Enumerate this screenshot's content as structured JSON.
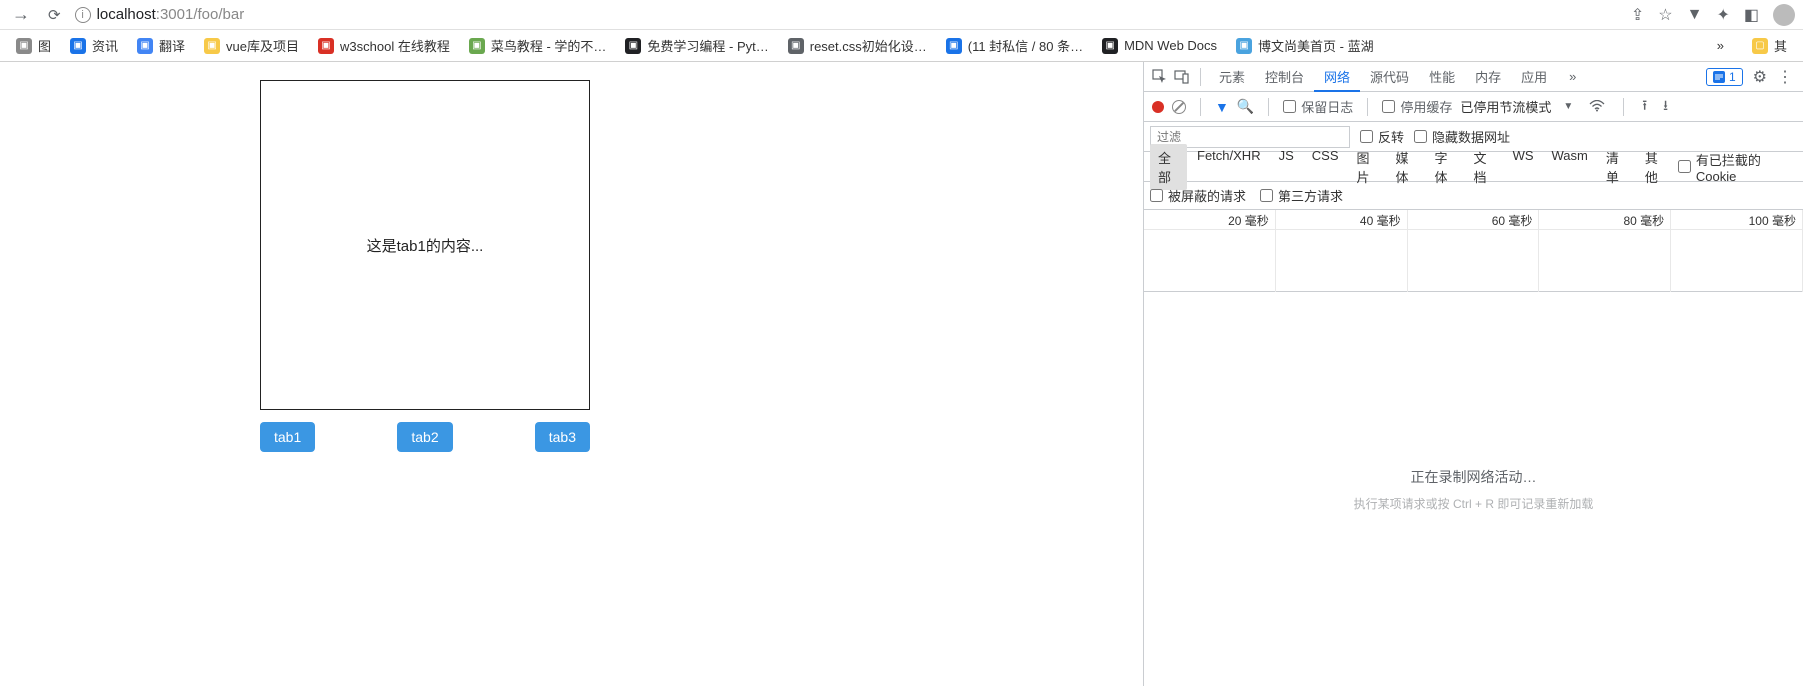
{
  "browser": {
    "url_display": "localhost:3001/foo/bar",
    "host": "localhost",
    "path": ":3001/foo/bar"
  },
  "bookmarks": [
    {
      "label": "图",
      "color": "#8a8a8a"
    },
    {
      "label": "资讯",
      "color": "#1a73e8"
    },
    {
      "label": "翻译",
      "color": "#4285f4"
    },
    {
      "label": "vue库及项目",
      "color": "#f7c948"
    },
    {
      "label": "w3school 在线教程",
      "color": "#d93025"
    },
    {
      "label": "菜鸟教程 - 学的不…",
      "color": "#6aa84f"
    },
    {
      "label": "免费学习编程 - Pyt…",
      "color": "#202124"
    },
    {
      "label": "reset.css初始化设…",
      "color": "#5f6368"
    },
    {
      "label": "(11 封私信 / 80 条…",
      "color": "#1a73e8"
    },
    {
      "label": "MDN Web Docs",
      "color": "#202124"
    },
    {
      "label": "博文尚美首页 - 蓝湖",
      "color": "#4aa3df"
    }
  ],
  "bookmarks_more": "»",
  "bookmarks_folder": "其",
  "page": {
    "content": "这是tab1的内容...",
    "tabs": [
      "tab1",
      "tab2",
      "tab3"
    ]
  },
  "devtools": {
    "tabs": [
      "元素",
      "控制台",
      "网络",
      "源代码",
      "性能",
      "内存",
      "应用"
    ],
    "active_tab": "网络",
    "more_tabs": "»",
    "issue_count": "1",
    "row2": {
      "preserve_log": "保留日志",
      "disable_cache": "停用缓存",
      "throttling": "已停用节流模式"
    },
    "row3": {
      "filter_placeholder": "过滤",
      "invert": "反转",
      "hide_data_urls": "隐藏数据网址"
    },
    "filters": [
      "全部",
      "Fetch/XHR",
      "JS",
      "CSS",
      "图片",
      "媒体",
      "字体",
      "文档",
      "WS",
      "Wasm",
      "清单",
      "其他"
    ],
    "active_filter": "全部",
    "blocked_cookies": "有已拦截的 Cookie",
    "row5": {
      "blocked_requests": "被屏蔽的请求",
      "third_party": "第三方请求"
    },
    "timeline_ticks": [
      "20 毫秒",
      "40 毫秒",
      "60 毫秒",
      "80 毫秒",
      "100 毫秒"
    ],
    "empty": {
      "line1": "正在录制网络活动…",
      "line2": "执行某项请求或按 Ctrl + R 即可记录重新加载"
    }
  }
}
